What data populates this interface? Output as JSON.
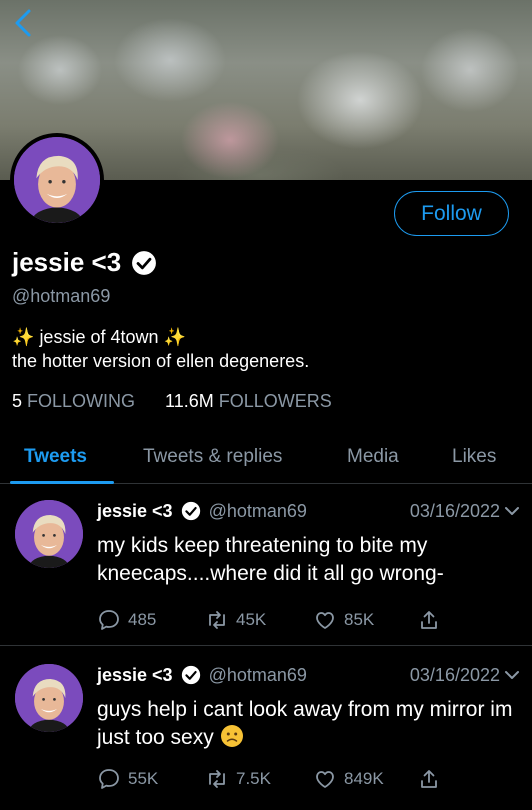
{
  "profile": {
    "display_name": "jessie <3",
    "handle": "@hotman69",
    "bio_line1": "jessie of 4town",
    "bio_line2": "the hotter version of ellen degeneres.",
    "sparkle": "✨",
    "following_count": "5",
    "following_label": "FOLLOWING",
    "followers_count": "11.6M",
    "followers_label": "FOLLOWERS",
    "follow_label": "Follow"
  },
  "tabs": [
    {
      "label": "Tweets",
      "active": true
    },
    {
      "label": "Tweets & replies",
      "active": false
    },
    {
      "label": "Media",
      "active": false
    },
    {
      "label": "Likes",
      "active": false
    }
  ],
  "tweets": [
    {
      "name": "jessie <3",
      "handle": "@hotman69",
      "date": "03/16/2022",
      "text": "my kids keep threatening to bite my kneecaps....where did it all go wrong-",
      "replies": "485",
      "retweets": "45K",
      "likes": "85K"
    },
    {
      "name": "jessie <3",
      "handle": "@hotman69",
      "date": "03/16/2022",
      "text": "guys help i cant look away from my mirror im just too sexy",
      "replies": "55K",
      "retweets": "7.5K",
      "likes": "849K"
    }
  ],
  "colors": {
    "accent": "#1d9bf0",
    "muted": "#8b98a5",
    "background": "#000000",
    "avatar_bg": "#7b4bbd"
  },
  "icons": [
    "back-arrow-icon",
    "verified-badge-icon",
    "chevron-down-icon",
    "reply-icon",
    "retweet-icon",
    "like-icon",
    "share-icon",
    "slightly-frowning-face-emoji"
  ]
}
